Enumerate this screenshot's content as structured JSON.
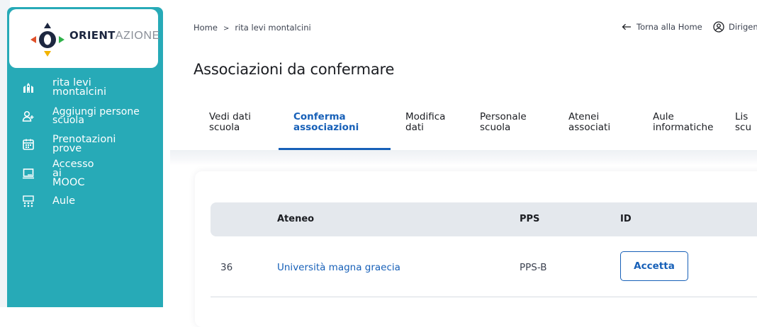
{
  "logo": {
    "bold": "ORIENT",
    "light": "AZIONE"
  },
  "sidebar": {
    "items": [
      {
        "label": "rita levi montalcini",
        "icon": "school-icon"
      },
      {
        "label": "Aggiungi persone scuola",
        "icon": "add-user-icon"
      },
      {
        "label": "Prenotazioni prove",
        "icon": "calendar-icon"
      },
      {
        "label": "Accesso ai MOOC",
        "icon": "laptop-icon"
      },
      {
        "label": "Aule",
        "icon": "classroom-icon"
      }
    ]
  },
  "breadcrumb": {
    "home": "Home",
    "separator": ">",
    "current": "rita levi montalcini"
  },
  "header": {
    "back_link": "Torna alla Home",
    "user": "Dirigen"
  },
  "page_title": "Associazioni da confermare",
  "tabs": [
    {
      "line1": "Vedi dati",
      "line2": "scuola"
    },
    {
      "line1": "Conferma",
      "line2": "associazioni",
      "active": true
    },
    {
      "line1": "Modifica",
      "line2": "dati"
    },
    {
      "line1": "Personale",
      "line2": "scuola"
    },
    {
      "line1": "Atenei",
      "line2": "associati"
    },
    {
      "line1": "Aule",
      "line2": "informatiche"
    },
    {
      "line1": "Lis",
      "line2": "scu"
    }
  ],
  "table": {
    "headers": {
      "ateneo": "Ateneo",
      "pps": "PPS",
      "id": "ID"
    },
    "rows": [
      {
        "num": "36",
        "ateneo": "Università magna graecia",
        "pps": "PPS-B",
        "action": "Accetta"
      }
    ]
  },
  "colors": {
    "sidebar": "#27aab7",
    "accent": "#1760b8",
    "header_bg": "#e4e8ed"
  }
}
